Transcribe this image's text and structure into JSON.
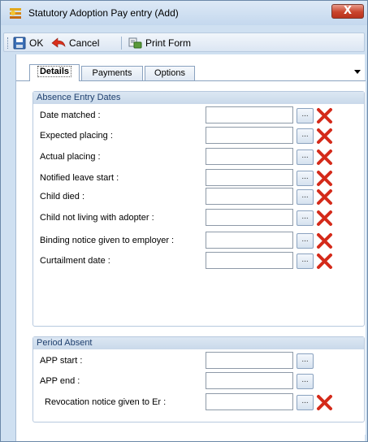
{
  "window": {
    "title": "Statutory Adoption Pay entry (Add)",
    "close_label": "X"
  },
  "toolbar": {
    "ok_label": "OK",
    "cancel_label": "Cancel",
    "print_label": "Print Form"
  },
  "tabs": [
    {
      "label": "Details",
      "active": true
    },
    {
      "label": "Payments",
      "active": false
    },
    {
      "label": "Options",
      "active": false
    }
  ],
  "absence_section": {
    "title": "Absence Entry Dates",
    "fields": [
      {
        "label": "Date matched :",
        "value": ""
      },
      {
        "label": "Expected placing :",
        "value": ""
      },
      {
        "label": "Actual placing :",
        "value": ""
      },
      {
        "label": "Notified leave start :",
        "value": ""
      },
      {
        "label": "Child died :",
        "value": ""
      },
      {
        "label": "Child not living with adopter :",
        "value": ""
      },
      {
        "label": "Binding notice given to employer :",
        "value": ""
      },
      {
        "label": "Curtailment date :",
        "value": ""
      }
    ]
  },
  "period_section": {
    "title": "Period Absent",
    "fields": [
      {
        "label": "APP start :",
        "value": ""
      },
      {
        "label": "APP end :",
        "value": ""
      },
      {
        "label": "Revocation notice given to Er :",
        "value": ""
      }
    ]
  },
  "ellipsis_label": "...",
  "colors": {
    "accent": "#c9d9ea",
    "clear_icon": "#d42a1a"
  }
}
